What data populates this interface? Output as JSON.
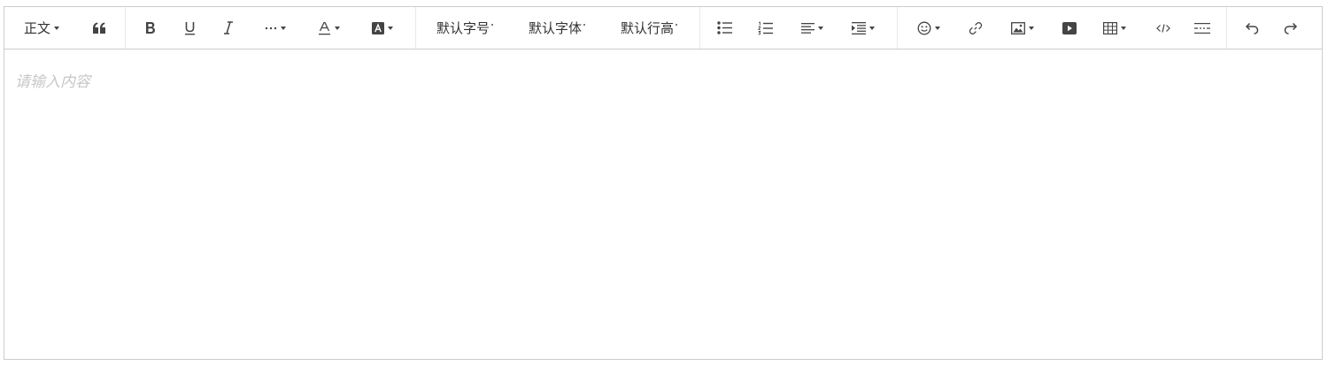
{
  "toolbar": {
    "heading_label": "正文",
    "font_size_label": "默认字号",
    "font_family_label": "默认字体",
    "line_height_label": "默认行高"
  },
  "editor": {
    "placeholder": "请输入内容"
  },
  "icons": [
    "quote-icon",
    "bold-icon",
    "underline-icon",
    "italic-icon",
    "more-icon",
    "font-color-icon",
    "background-color-icon",
    "bulleted-list-icon",
    "numbered-list-icon",
    "align-icon",
    "indent-icon",
    "emotion-icon",
    "link-icon",
    "image-icon",
    "video-icon",
    "table-icon",
    "code-icon",
    "divider-icon",
    "undo-icon",
    "redo-icon"
  ],
  "colors": {
    "border": "#cccccc",
    "icon": "#444444",
    "placeholder": "#c7c7c7"
  }
}
